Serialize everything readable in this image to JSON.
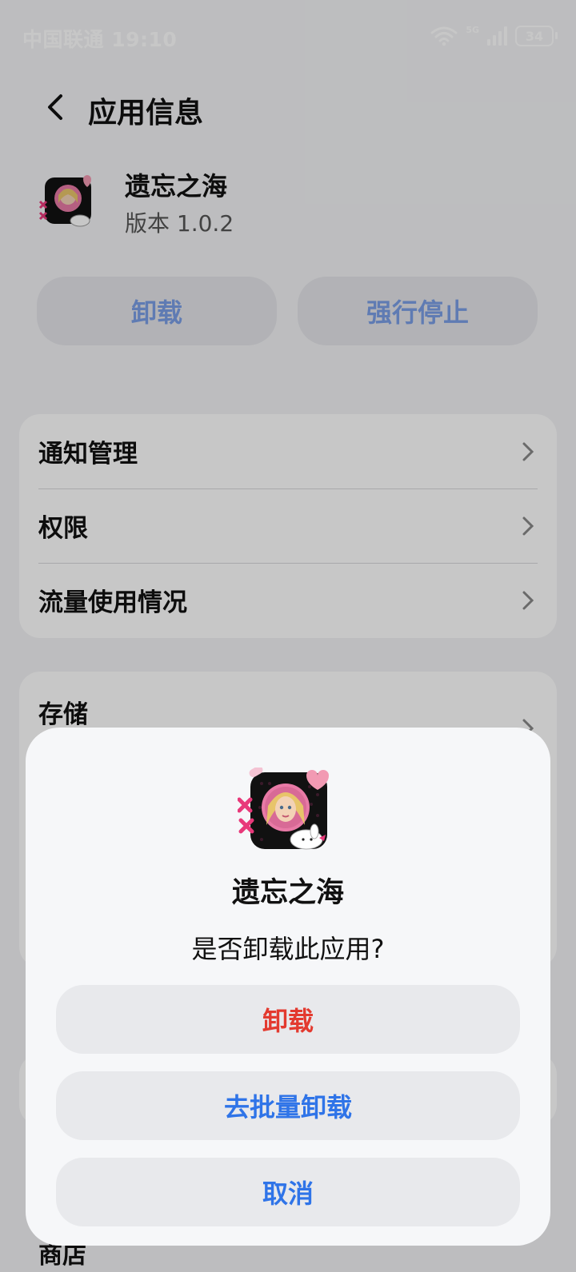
{
  "status_bar": {
    "carrier_time": "中国联通 19:10",
    "network": "5G",
    "battery": "34"
  },
  "header": {
    "title": "应用信息"
  },
  "app": {
    "name": "遗忘之海",
    "version": "版本 1.0.2"
  },
  "actions": {
    "uninstall": "卸载",
    "force_stop": "强行停止"
  },
  "settings_card": {
    "items": [
      {
        "label": "通知管理"
      },
      {
        "label": "权限"
      },
      {
        "label": "流量使用情况"
      }
    ]
  },
  "storage_card": {
    "label": "存储"
  },
  "store_label": "商店",
  "dialog": {
    "app_name": "遗忘之海",
    "question": "是否卸载此应用?",
    "uninstall": "卸载",
    "batch_uninstall": "去批量卸载",
    "cancel": "取消"
  },
  "colors": {
    "danger": "#e33a2f",
    "accent": "#2f74e8",
    "disabled_accent": "#7a9ee6"
  }
}
